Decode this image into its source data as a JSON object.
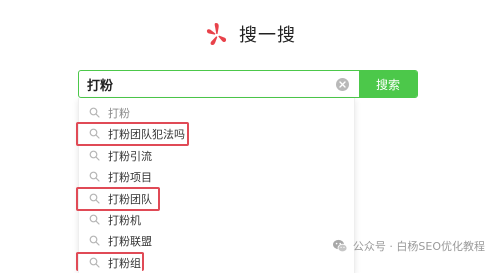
{
  "logo": {
    "text": "搜一搜"
  },
  "search": {
    "value": "打粉",
    "button_label": "搜索"
  },
  "suggestions": [
    {
      "text": "打粉",
      "highlighted": false
    },
    {
      "text": "打粉团队犯法吗",
      "highlighted": true
    },
    {
      "text": "打粉引流",
      "highlighted": false
    },
    {
      "text": "打粉项目",
      "highlighted": false
    },
    {
      "text": "打粉团队",
      "highlighted": true
    },
    {
      "text": "打粉机",
      "highlighted": false
    },
    {
      "text": "打粉联盟",
      "highlighted": false
    },
    {
      "text": "打粉组",
      "highlighted": true
    }
  ],
  "watermark": {
    "text": "公众号 · 白杨SEO优化教程"
  },
  "colors": {
    "accent": "#4cc84a",
    "highlight_box": "#e04a56",
    "logo_red": "#e8424a"
  }
}
